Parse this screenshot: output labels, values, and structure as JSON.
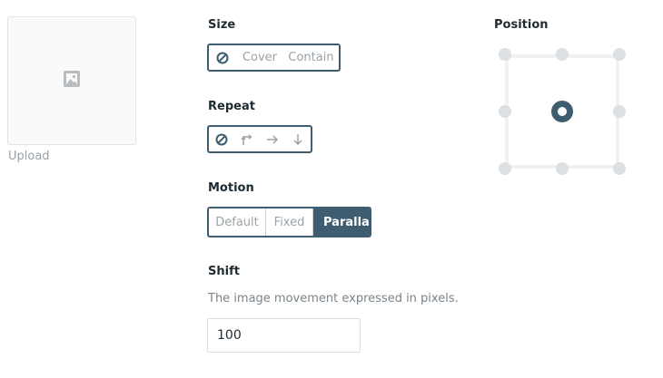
{
  "upload": {
    "label": "Upload",
    "icon": "image-icon"
  },
  "size": {
    "title": "Size",
    "options": [
      {
        "icon": "none-icon"
      },
      {
        "label": "Cover"
      },
      {
        "label": "Contain"
      }
    ]
  },
  "repeat": {
    "title": "Repeat",
    "options": [
      {
        "icon": "none-icon"
      },
      {
        "icon": "repeat-both-icon"
      },
      {
        "icon": "arrow-right-icon"
      },
      {
        "icon": "arrow-down-icon"
      }
    ]
  },
  "motion": {
    "title": "Motion",
    "options": [
      {
        "label": "Default"
      },
      {
        "label": "Fixed"
      },
      {
        "label": "Parallax",
        "active": true
      }
    ]
  },
  "shift": {
    "title": "Shift",
    "description": "The image movement expressed in pixels.",
    "value": "100"
  },
  "position": {
    "title": "Position",
    "selected": "center-center"
  },
  "colors": {
    "accent": "#3e5d70",
    "muted_text": "#9aa3a9",
    "dot": "#dde0e2"
  }
}
